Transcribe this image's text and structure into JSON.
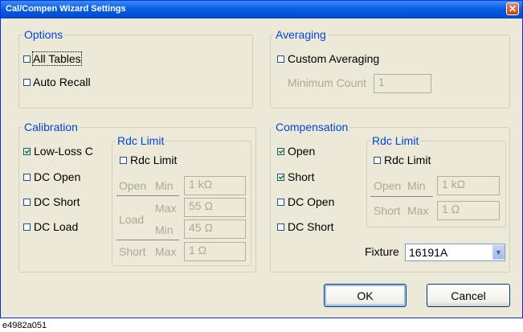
{
  "window": {
    "title": "Cal/Compen Wizard Settings",
    "close_glyph": "✕"
  },
  "options": {
    "legend": "Options",
    "all_tables": "All Tables",
    "auto_recall": "Auto Recall"
  },
  "averaging": {
    "legend": "Averaging",
    "custom_averaging": "Custom Averaging",
    "minimum_count_label": "Minimum Count",
    "minimum_count_value": "1"
  },
  "calibration": {
    "legend": "Calibration",
    "low_loss_c": "Low-Loss C",
    "dc_open": "DC Open",
    "dc_short": "DC Short",
    "dc_load": "DC Load",
    "rdc": {
      "legend": "Rdc Limit",
      "checkbox": "Rdc Limit",
      "open": "Open",
      "load": "Load",
      "short": "Short",
      "min": "Min",
      "max": "Max",
      "open_min": "1 kΩ",
      "load_max": "55 Ω",
      "load_min": "45 Ω",
      "short_max": "1 Ω"
    }
  },
  "compensation": {
    "legend": "Compensation",
    "open": "Open",
    "short": "Short",
    "dc_open": "DC Open",
    "dc_short": "DC Short",
    "rdc": {
      "legend": "Rdc Limit",
      "checkbox": "Rdc Limit",
      "open": "Open",
      "short": "Short",
      "min": "Min",
      "max": "Max",
      "open_min": "1 kΩ",
      "short_max": "1 Ω"
    },
    "fixture_label": "Fixture",
    "fixture_value": "16191A"
  },
  "buttons": {
    "ok": "OK",
    "cancel": "Cancel"
  },
  "caption": "e4982a051"
}
